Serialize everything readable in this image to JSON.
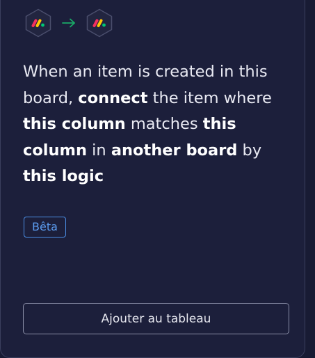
{
  "recipe": {
    "description_parts": [
      {
        "text": "When an item is created in this board, ",
        "bold": false
      },
      {
        "text": "connect",
        "bold": true
      },
      {
        "text": " the item where ",
        "bold": false
      },
      {
        "text": "this column",
        "bold": true
      },
      {
        "text": " matches ",
        "bold": false
      },
      {
        "text": "this column",
        "bold": true
      },
      {
        "text": " in ",
        "bold": false
      },
      {
        "text": "another board",
        "bold": true
      },
      {
        "text": " by ",
        "bold": false
      },
      {
        "text": "this logic",
        "bold": true
      }
    ],
    "badge": "Bêta",
    "add_button": "Ajouter au tableau"
  },
  "icons": {
    "source": "monday-logo-icon",
    "arrow": "arrow-right-icon",
    "target": "monday-logo-icon"
  },
  "colors": {
    "background": "#181b34",
    "card": "#1c1f3b",
    "badge": "#5b9bee",
    "arrow": "#1aaa67",
    "logo_red": "#f5305f",
    "logo_yellow": "#ffc703",
    "logo_green": "#00c875"
  }
}
